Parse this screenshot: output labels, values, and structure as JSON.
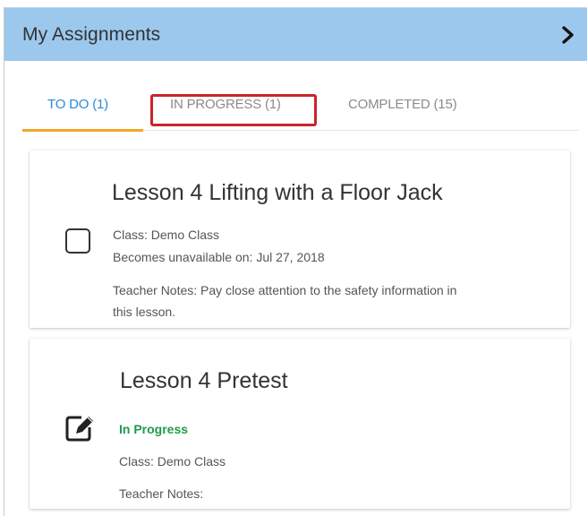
{
  "header": {
    "title": "My Assignments",
    "chevron_icon": "chevron-right-icon"
  },
  "tabs": [
    {
      "label": "TO DO (1)",
      "active": true
    },
    {
      "label": "IN PROGRESS (1)",
      "active": false,
      "highlighted": true
    },
    {
      "label": "COMPLETED (15)",
      "active": false
    }
  ],
  "colors": {
    "header_bg": "#9cc8ee",
    "active_tab_text": "#2a8ad8",
    "active_tab_underline": "#f5a623",
    "highlight_border": "#c9242a",
    "status_green": "#1e9a4a"
  },
  "assignments": [
    {
      "title": "Lesson 4 Lifting with a Floor Jack",
      "icon": "checkbox-icon",
      "class_line": "Class: Demo Class",
      "unavailable_line": "Becomes unavailable on: Jul 27, 2018",
      "notes_line1": "Teacher Notes: Pay close attention to the safety information in",
      "notes_line2": "this lesson."
    },
    {
      "title": "Lesson 4 Pretest",
      "icon": "edit-icon",
      "status": "In Progress",
      "class_line": "Class: Demo Class",
      "notes_line1": "Teacher Notes:"
    }
  ]
}
